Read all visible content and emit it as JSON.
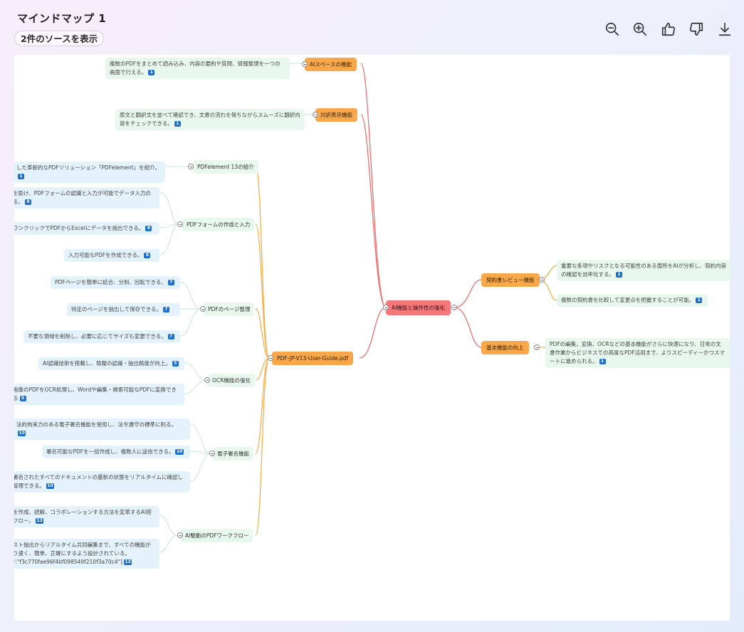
{
  "header": {
    "title": "マインドマップ 1",
    "source_chip": "2件のソースを表示"
  },
  "toolbar": {
    "icons": [
      "zoom-out-icon",
      "zoom-in-icon",
      "thumbs-up-icon",
      "thumbs-down-icon",
      "download-icon"
    ]
  },
  "mindmap": {
    "center": "AI機能と操作性の強化",
    "ai_space": {
      "label": "AIスペースの機能",
      "leaf": "複数のPDFをまとめて読み込み、内容の要約や質問、情報整理を一つの画面で行える。",
      "cite": "1"
    },
    "translation": {
      "label": "対訳表示機能",
      "leaf": "原文と翻訳文を並べて確認でき、文書の流れを保ちながらスムーズに翻訳内容をチェックできる。",
      "cite": "1"
    },
    "contract": {
      "label": "契約書レビュー機能",
      "leaf1": "重要な条項やリスクとなる可能性のある箇所をAIが分析し、契約内容の確認を効率化する。",
      "cite1": "1",
      "leaf2": "複数の契約書を比較して変更点を把握することが可能。",
      "cite2": "1"
    },
    "basic": {
      "label": "基本機能の向上",
      "leaf": "PDFの編集、変換、OCRなどの基本機能がさらに快適になり、日常の文書作業からビジネスでの高度なPDF活用まで、よりスピーディーかつスマートに進められる。",
      "cite": "1"
    },
    "pdf_main": {
      "label": "PDF-JP-V13-User-Guide.pdf",
      "intro": {
        "label": "PDFelement 13の紹介",
        "leaf": "した革新的なPDFソリューション「PDFelement」を紹介。",
        "cite": "1"
      },
      "form": {
        "label": "PDFフォームの作成と入力",
        "leaf1": "を助け、PDFフォームの認識と入力が可能でデータ入力の る。",
        "cite1": "8",
        "leaf2": "ワンクリックでPDFからExcelにデータを抽出できる。",
        "cite2": "8",
        "leaf3": "入力可能なPDFを作成できる。",
        "cite3": "8"
      },
      "pages": {
        "label": "PDFのページ整理",
        "leaf1": "PDFページを簡単に結合、分割、回転できる。",
        "cite1": "7",
        "leaf2": "特定のページを抽出して保存できる。",
        "cite2": "7",
        "leaf3": "不要な領域を削除し、必要に応じてサイズも変更できる。",
        "cite3": "7"
      },
      "ocr": {
        "label": "OCR機能の強化",
        "leaf1": "AI認識技術を搭載し、情報の認識・抽出精度が向上。",
        "cite1": "5",
        "leaf2": "画像のPDFをOCR処理し、Wordや編集・検索可能なPDFに変換できる",
        "cite2": "5"
      },
      "esign": {
        "label": "電子署名機能",
        "leaf1": "法的拘束力のある電子署名機能を使用し、法令遵守の標準に則る。",
        "cite1": "10",
        "leaf2": "署名可能なPDFを一括作成し、複数人に送信できる。",
        "cite2": "10",
        "leaf3": "署名されたすべてのドキュメントの最新の状態をリアルタイムに確認し 管理できる。",
        "cite3": "10"
      },
      "workflow": {
        "label": "AI駆動のPDFワークフロー",
        "leaf1": "を作成、読解、コラボレーションする方法を変革するAI搭 フロー。",
        "cite1": "13",
        "leaf2": "スト抽出からリアルタイム共同編集まで、すべての機能が り速く、簡単、正確にするよう設計されている。 \":\"f3c770fae96f4bf098549f210f3a70c4\"]",
        "cite2": "13"
      }
    }
  }
}
